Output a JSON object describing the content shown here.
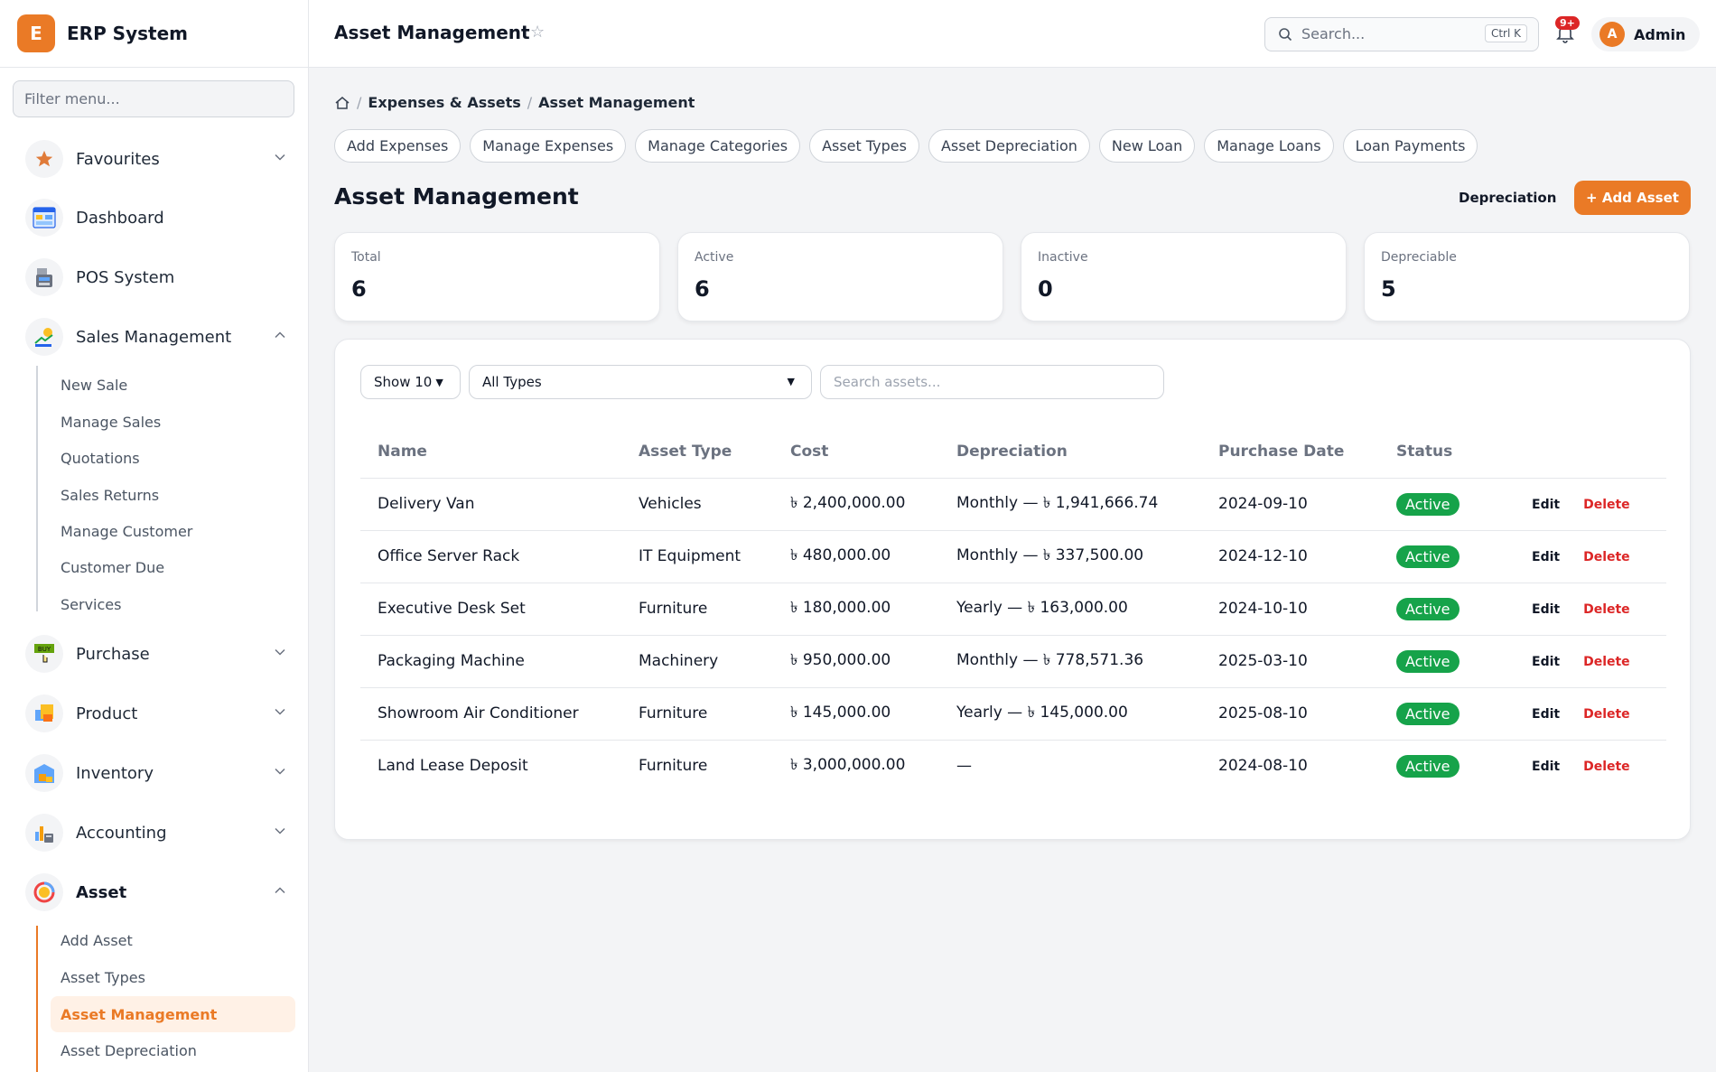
{
  "brand": {
    "logo_letter": "E",
    "name": "ERP System"
  },
  "sidebar": {
    "filter_placeholder": "Filter menu...",
    "items": [
      {
        "label": "Favourites",
        "icon": "star-icon"
      },
      {
        "label": "Dashboard",
        "icon": "dashboard-icon"
      },
      {
        "label": "POS System",
        "icon": "pos-icon"
      },
      {
        "label": "Sales Management",
        "icon": "sales-icon"
      },
      {
        "label": "Purchase",
        "icon": "purchase-icon"
      },
      {
        "label": "Product",
        "icon": "product-icon"
      },
      {
        "label": "Inventory",
        "icon": "inventory-icon"
      },
      {
        "label": "Accounting",
        "icon": "accounting-icon"
      },
      {
        "label": "Asset",
        "icon": "asset-icon"
      }
    ],
    "sales_sub": [
      "New Sale",
      "Manage Sales",
      "Quotations",
      "Sales Returns",
      "Manage Customer",
      "Customer Due",
      "Services"
    ],
    "asset_sub": [
      "Add Asset",
      "Asset Types",
      "Asset Management",
      "Asset Depreciation"
    ]
  },
  "topbar": {
    "title": "Asset Management",
    "search_placeholder": "Search...",
    "shortcut": "Ctrl K",
    "notification_count": "9+",
    "user_initial": "A",
    "user_name": "Admin"
  },
  "breadcrumb": {
    "parent": "Expenses & Assets",
    "current": "Asset Management"
  },
  "quick_links": [
    "Add Expenses",
    "Manage Expenses",
    "Manage Categories",
    "Asset Types",
    "Asset Depreciation",
    "New Loan",
    "Manage Loans",
    "Loan Payments"
  ],
  "page": {
    "title": "Asset Management",
    "depreciation_btn": "Depreciation",
    "add_btn": "+ Add Asset"
  },
  "stats": [
    {
      "label": "Total",
      "value": "6"
    },
    {
      "label": "Active",
      "value": "6"
    },
    {
      "label": "Inactive",
      "value": "0"
    },
    {
      "label": "Depreciable",
      "value": "5"
    }
  ],
  "controls": {
    "show": "Show 10",
    "type_filter": "All Types",
    "search_placeholder": "Search assets..."
  },
  "table": {
    "headers": [
      "Name",
      "Asset Type",
      "Cost",
      "Depreciation",
      "Purchase Date",
      "Status"
    ],
    "edit_label": "Edit",
    "delete_label": "Delete",
    "rows": [
      {
        "name": "Delivery Van",
        "type": "Vehicles",
        "cost": "৳ 2,400,000.00",
        "depreciation": "Monthly — ৳ 1,941,666.74",
        "date": "2024-09-10",
        "status": "Active"
      },
      {
        "name": "Office Server Rack",
        "type": "IT Equipment",
        "cost": "৳ 480,000.00",
        "depreciation": "Monthly — ৳ 337,500.00",
        "date": "2024-12-10",
        "status": "Active"
      },
      {
        "name": "Executive Desk Set",
        "type": "Furniture",
        "cost": "৳ 180,000.00",
        "depreciation": "Yearly — ৳ 163,000.00",
        "date": "2024-10-10",
        "status": "Active"
      },
      {
        "name": "Packaging Machine",
        "type": "Machinery",
        "cost": "৳ 950,000.00",
        "depreciation": "Monthly — ৳ 778,571.36",
        "date": "2025-03-10",
        "status": "Active"
      },
      {
        "name": "Showroom Air Conditioner",
        "type": "Furniture",
        "cost": "৳ 145,000.00",
        "depreciation": "Yearly — ৳ 145,000.00",
        "date": "2025-08-10",
        "status": "Active"
      },
      {
        "name": "Land Lease Deposit",
        "type": "Furniture",
        "cost": "৳ 3,000,000.00",
        "depreciation": "—",
        "date": "2024-08-10",
        "status": "Active"
      }
    ]
  },
  "colors": {
    "accent": "#ea7a26",
    "status_active": "#16a34a",
    "danger": "#dc2626"
  }
}
